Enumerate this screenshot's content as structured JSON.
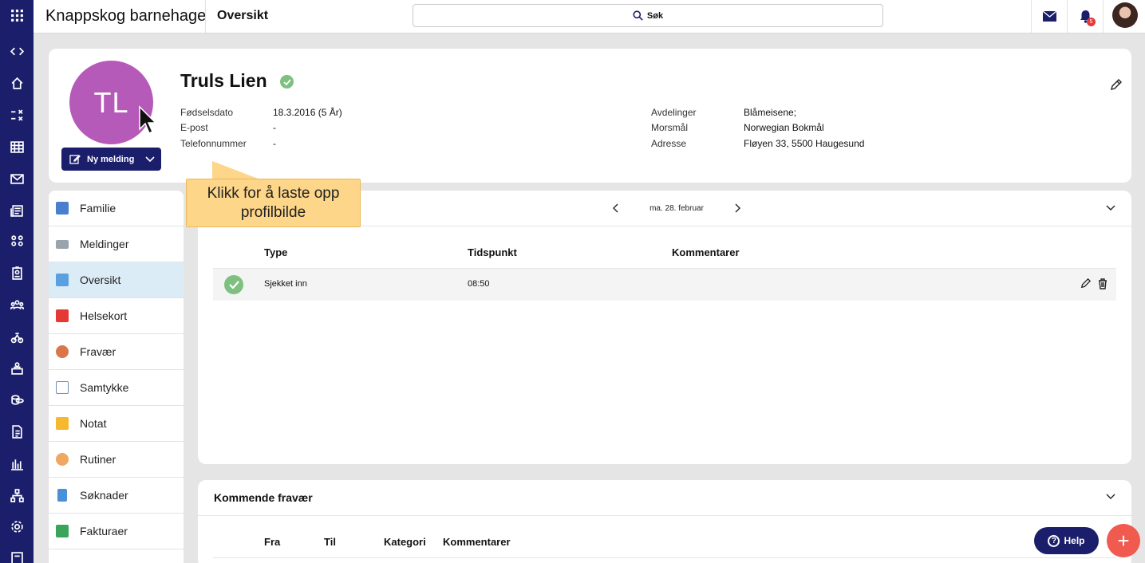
{
  "topbar": {
    "app_title": "Knappskog barnehage",
    "page_title": "Oversikt",
    "search_label": "Søk",
    "notification_count": "5"
  },
  "profile": {
    "initials": "TL",
    "name": "Truls Lien",
    "new_message_label": "Ny melding",
    "left_fields": [
      {
        "label": "Fødselsdato",
        "value": "18.3.2016 (5 År)"
      },
      {
        "label": "E-post",
        "value": "-"
      },
      {
        "label": "Telefonnummer",
        "value": "-"
      }
    ],
    "right_fields": [
      {
        "label": "Avdelinger",
        "value": "Blåmeisene;"
      },
      {
        "label": "Morsmål",
        "value": "Norwegian Bokmål"
      },
      {
        "label": "Adresse",
        "value": "Fløyen 33, 5500 Haugesund"
      }
    ]
  },
  "tooltip": {
    "line1": "Klikk for å laste opp",
    "line2": "profilbilde"
  },
  "menu": {
    "items": [
      {
        "label": "Familie",
        "icon": "family-icon",
        "color": "#4a7fd0"
      },
      {
        "label": "Meldinger",
        "icon": "envelope-icon",
        "color": "#9aa4ad"
      },
      {
        "label": "Oversikt",
        "icon": "magnifier-icon",
        "color": "#5aa0e0"
      },
      {
        "label": "Helsekort",
        "icon": "health-card-icon",
        "color": "#e53935"
      },
      {
        "label": "Fravær",
        "icon": "absence-icon",
        "color": "#d9774b"
      },
      {
        "label": "Samtykke",
        "icon": "checklist-icon",
        "color": "#6d8fb5"
      },
      {
        "label": "Notat",
        "icon": "note-icon",
        "color": "#f5b82e"
      },
      {
        "label": "Rutiner",
        "icon": "baby-icon",
        "color": "#f0a860"
      },
      {
        "label": "Søknader",
        "icon": "application-icon",
        "color": "#4a90d9"
      },
      {
        "label": "Fakturaer",
        "icon": "invoice-icon",
        "color": "#3aa55a"
      }
    ]
  },
  "overview": {
    "date_label": "ma. 28. februar",
    "columns": [
      "Type",
      "Tidspunkt",
      "Kommentarer"
    ],
    "rows": [
      {
        "type": "Sjekket inn",
        "time": "08:50",
        "comment": ""
      }
    ]
  },
  "absence": {
    "title": "Kommende fravær",
    "columns": [
      "Fra",
      "Til",
      "Kategori",
      "Kommentarer"
    ]
  },
  "help_label": "Help",
  "colors": {
    "navy": "#1b1f6b",
    "avatar": "#b65ab9",
    "check": "#7dc07f",
    "fab": "#f05a4f",
    "tooltip": "#fdd68a"
  }
}
